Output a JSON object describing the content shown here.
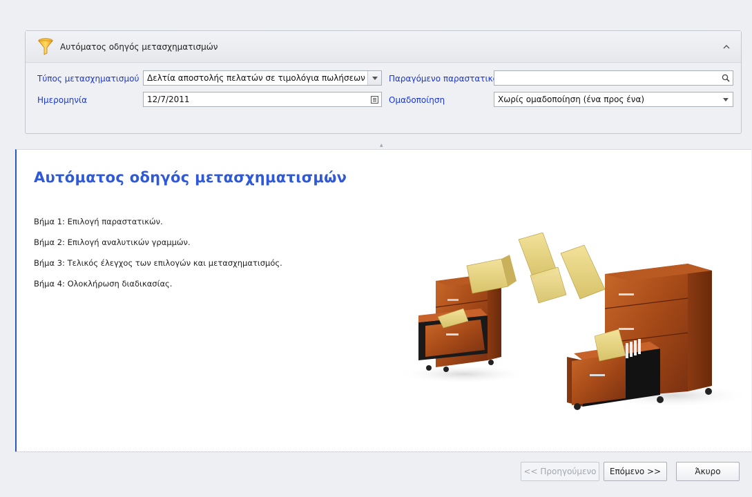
{
  "group": {
    "title": "Αυτόματος οδηγός μετασχηματισμών",
    "funnel_icon": "funnel-icon",
    "collapse_icon": "chevron-up-icon"
  },
  "form": {
    "transformation_type_label": "Τύπος μετασχηματισμού",
    "transformation_type_value": "Δελτία αποστολής πελατών σε τιμολόγια πωλήσεων",
    "date_label": "Ημερομηνία",
    "date_value": "12/7/2011",
    "produced_document_label": "Παραγόμενο παραστατικό",
    "produced_document_value": "",
    "grouping_label": "Ομαδοποίηση",
    "grouping_value": "Χωρίς ομαδοποίηση (ένα προς ένα)"
  },
  "content": {
    "title": "Αυτόματος οδηγός μετασχηματισμών",
    "steps": [
      "Βήμα 1: Επιλογή παραστατικών.",
      "Βήμα 2: Επιλογή αναλυτικών γραμμών.",
      "Βήμα 3: Τελικός έλεγχος των επιλογών και μετασχηματισμός.",
      "Βήμα 4: Ολοκλήρωση διαδικασίας."
    ]
  },
  "footer": {
    "previous_label": "<< Προηγούμενο",
    "next_label": "Επόμενο >>",
    "cancel_label": "Άκυρο"
  },
  "colors": {
    "accent": "#2f59d7",
    "label_blue": "#1a37d6",
    "background": "#edeff3"
  }
}
